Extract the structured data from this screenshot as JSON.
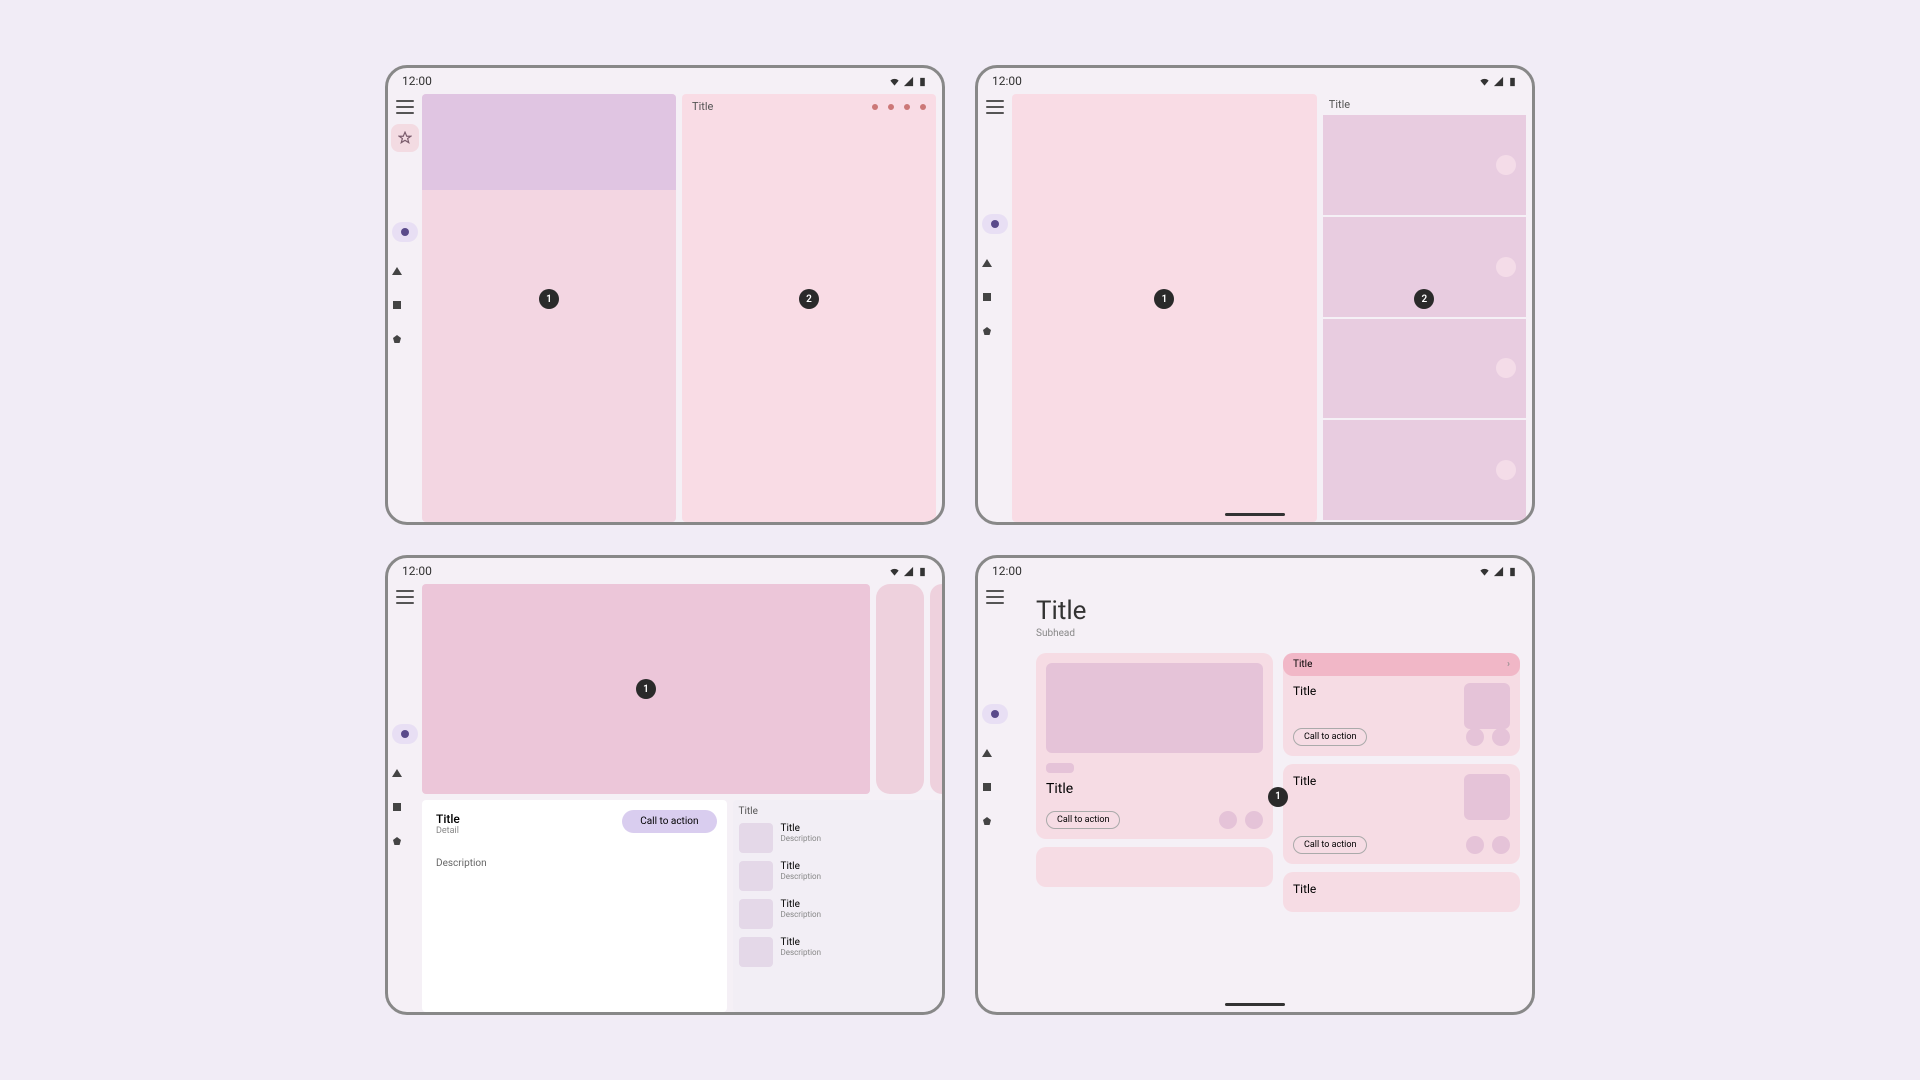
{
  "status_time": "12:00",
  "badges": {
    "one": "1",
    "two": "2"
  },
  "mock1": {
    "right_title": "Title"
  },
  "mock2": {
    "right_title": "Title"
  },
  "mock3": {
    "detail_title": "Title",
    "detail_sub": "Detail",
    "cta": "Call to action",
    "description": "Description",
    "list_title": "Title",
    "items": [
      {
        "title": "Title",
        "desc": "Description"
      },
      {
        "title": "Title",
        "desc": "Description"
      },
      {
        "title": "Title",
        "desc": "Description"
      },
      {
        "title": "Title",
        "desc": "Description"
      }
    ]
  },
  "mock4": {
    "title": "Title",
    "subhead": "Subhead",
    "pill_title": "Title",
    "card_title": "Title",
    "cta": "Call to action"
  }
}
